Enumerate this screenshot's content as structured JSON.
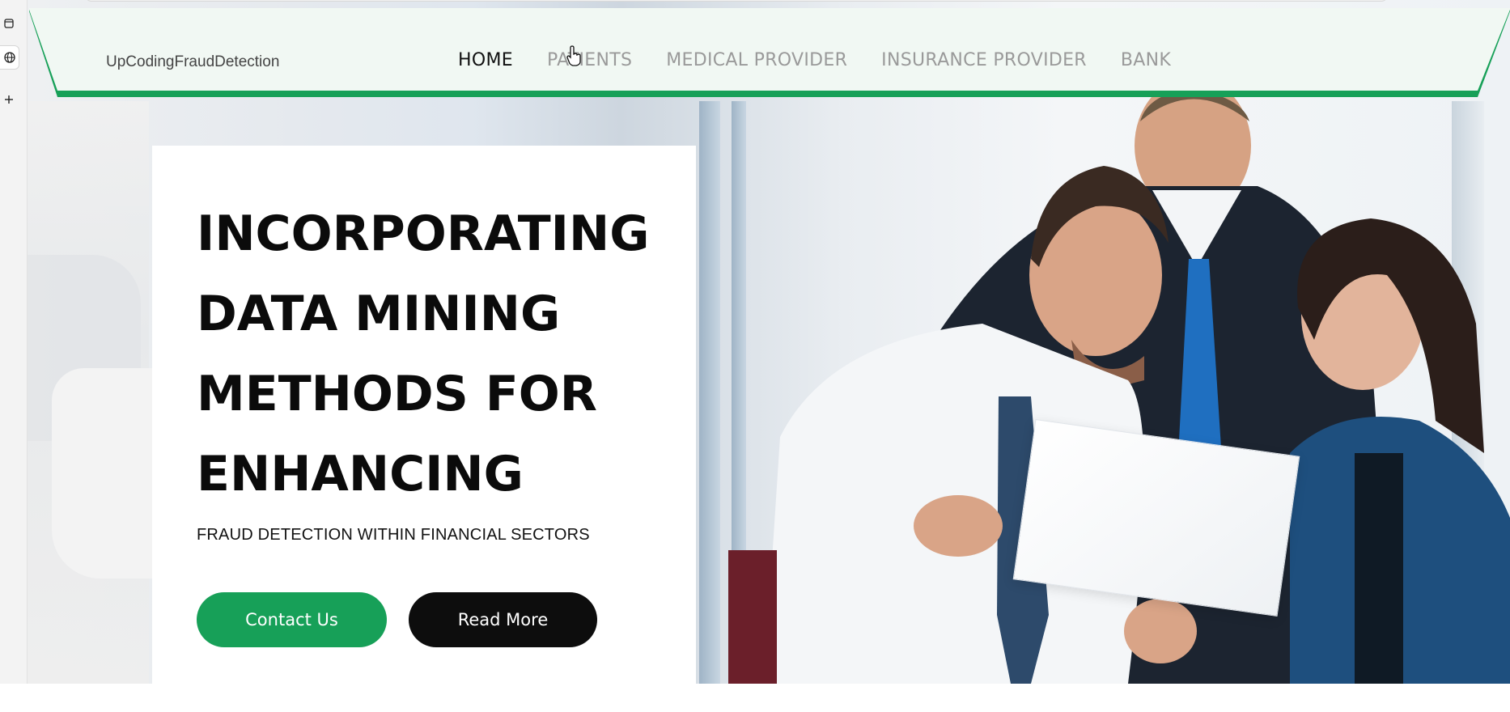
{
  "browser": {
    "side_icons": [
      "tab-icon",
      "globe-icon",
      "plus-icon"
    ]
  },
  "nav": {
    "brand": "UpCodingFraudDetection",
    "links": [
      {
        "label": "HOME",
        "active": true
      },
      {
        "label": "PATIENTS",
        "active": false
      },
      {
        "label": "MEDICAL PROVIDER",
        "active": false
      },
      {
        "label": "INSURANCE PROVIDER",
        "active": false
      },
      {
        "label": "BANK",
        "active": false
      }
    ]
  },
  "hero": {
    "headline_lines": [
      "INCORPORATING",
      "DATA MINING",
      "METHODS FOR",
      "ENHANCING"
    ],
    "subheading": "FRAUD DETECTION WITHIN FINANCIAL SECTORS",
    "contact_button": "Contact Us",
    "read_more_button": "Read More"
  },
  "colors": {
    "accent_green": "#17a058",
    "nav_bg": "#f1f8f3",
    "dark_button": "#0d0d0d"
  }
}
